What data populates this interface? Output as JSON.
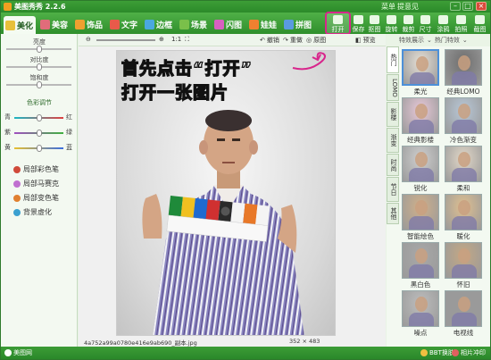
{
  "app": {
    "title": "美图秀秀 2.2.6",
    "menu": "菜单",
    "feedback": "提意见"
  },
  "nav": {
    "tabs": [
      {
        "label": "美化",
        "icon": "beautify-icon",
        "color": "#e8c03a"
      },
      {
        "label": "美容",
        "icon": "makeup-icon",
        "color": "#e06c7a"
      },
      {
        "label": "饰品",
        "icon": "accessory-icon",
        "color": "#f0a030"
      },
      {
        "label": "文字",
        "icon": "text-icon",
        "color": "#e85a4a"
      },
      {
        "label": "边框",
        "icon": "border-icon",
        "color": "#4aa8e0"
      },
      {
        "label": "场景",
        "icon": "scene-icon",
        "color": "#7ac04a"
      },
      {
        "label": "闪图",
        "icon": "flash-icon",
        "color": "#d860c0"
      },
      {
        "label": "娃娃",
        "icon": "doll-icon",
        "color": "#f08030"
      },
      {
        "label": "拼图",
        "icon": "puzzle-icon",
        "color": "#5a9ae0"
      }
    ],
    "tools": [
      "打开",
      "保存",
      "抠图",
      "旋转",
      "裁剪",
      "尺寸",
      "涂鸦",
      "拍照",
      "截图"
    ]
  },
  "left": {
    "adjust": {
      "labels": [
        "亮度",
        "对比度",
        "饱和度"
      ],
      "levels": [
        0.5,
        0.5,
        0.5
      ]
    },
    "color_title": "色彩调节",
    "color_rows": [
      {
        "l": "青",
        "r": "红",
        "from": "#1bb7c4",
        "to": "#e04040",
        "level": 0.5
      },
      {
        "l": "紫",
        "r": "绿",
        "from": "#a050c0",
        "to": "#40b040",
        "level": 0.5
      },
      {
        "l": "黄",
        "r": "蓝",
        "from": "#e8c030",
        "to": "#3a6ee0",
        "level": 0.5
      }
    ],
    "functions": [
      {
        "label": "局部彩色笔",
        "color": "#d04a3a"
      },
      {
        "label": "局部马赛克",
        "color": "#c070d0"
      },
      {
        "label": "局部变色笔",
        "color": "#e08030"
      },
      {
        "label": "背景虚化",
        "color": "#3aa0d0"
      }
    ]
  },
  "toolbar": {
    "zoom": "1:1",
    "undo": "撤销",
    "redo": "重做",
    "original": "原图",
    "preview": "预览"
  },
  "canvas": {
    "line1": "首先点击“打开”",
    "line2": "打开一张图片"
  },
  "info": {
    "filename": "4a752a99a0780e416e9ab690_副本.jpg",
    "size": "352 × 483"
  },
  "right": {
    "header": {
      "left": "特效展示",
      "right": "热门特效"
    },
    "side_tabs": [
      "热门",
      "LOMO",
      "影楼",
      "渐变",
      "时尚",
      "节日",
      "其他"
    ],
    "effects": [
      {
        "label": "柔光",
        "tint": "#e6e0d6"
      },
      {
        "label": "经典LOMO",
        "tint": "#6e6e6e"
      },
      {
        "label": "经典影楼",
        "tint": "#e8c8d8"
      },
      {
        "label": "冷色渐变",
        "tint": "#b8c8d8"
      },
      {
        "label": "锐化",
        "tint": "#cfcfcf"
      },
      {
        "label": "柔和",
        "tint": "#e2d8c8"
      },
      {
        "label": "智能绘色",
        "tint": "#d0b08a"
      },
      {
        "label": "暖化",
        "tint": "#e0c090"
      },
      {
        "label": "黑白色",
        "tint": "#a8a8a8"
      },
      {
        "label": "怀旧",
        "tint": "#c4a884"
      },
      {
        "label": "噪点",
        "tint": "#bdbdbd"
      },
      {
        "label": "电视线",
        "tint": "#9a9a9a"
      }
    ]
  },
  "status": {
    "site": "美图网",
    "skin": "BBT换肤",
    "album": "相片冲印"
  }
}
